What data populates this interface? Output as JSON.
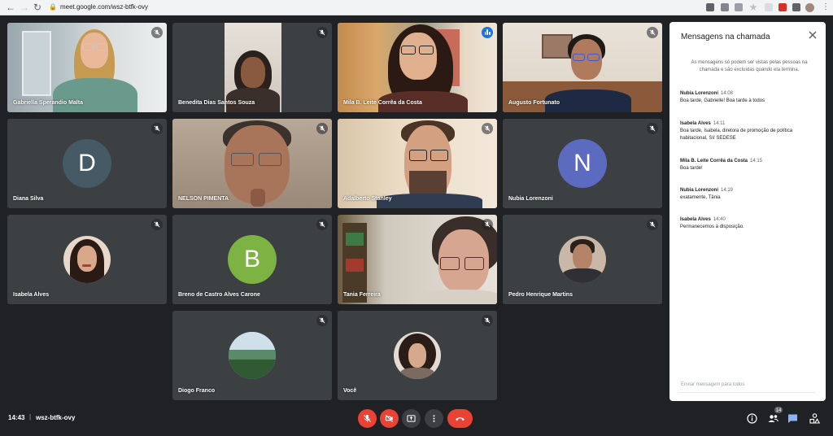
{
  "browser": {
    "url": "meet.google.com/wsz-btfk-ovy",
    "back_glyph": "←",
    "forward_glyph": "→",
    "reload_glyph": "↻"
  },
  "participants": [
    {
      "name": "Gabriella Sperandio Malta",
      "muted": true
    },
    {
      "name": "Benedita Dias Santos Souza",
      "muted": true
    },
    {
      "name": "Mila B. Leite Corrêa da Costa",
      "muted": false,
      "speaking": true
    },
    {
      "name": "Augusto Fortunato",
      "muted": true
    },
    {
      "name": "Diana Silva",
      "muted": true,
      "initial": "D"
    },
    {
      "name": "NELSON PIMENTA",
      "muted": true
    },
    {
      "name": "Adalberto Stanley",
      "muted": true
    },
    {
      "name": "Nubia Lorenzoni",
      "muted": true,
      "initial": "N"
    },
    {
      "name": "Isabela Alves",
      "muted": true
    },
    {
      "name": "Breno de Castro Alves Carone",
      "muted": true,
      "initial": "B"
    },
    {
      "name": "Tania Ferreira",
      "muted": true
    },
    {
      "name": "Pedro Henrique Martins",
      "muted": true
    },
    {
      "name": "Diogo Franco",
      "muted": true
    },
    {
      "name": "Você",
      "muted": true
    }
  ],
  "chat": {
    "title": "Mensagens na chamada",
    "notice": "As mensagens só podem ser vistas pelas pessoas na chamada e são excluídas quando ela termina.",
    "messages": [
      {
        "sender": "Nubia Lorenzoni",
        "time": "14:08",
        "text": "Boa tarde, Gabrielle! Boa tarde à todos"
      },
      {
        "sender": "Isabela Alves",
        "time": "14:11",
        "text": "Boa tarde, Isabela, diretora de promoção de política habitacional, SI/ SEDESE"
      },
      {
        "sender": "Mila B. Leite Corrêa da Costa",
        "time": "14:15",
        "text": "Boa tarde!"
      },
      {
        "sender": "Nubia Lorenzoni",
        "time": "14:19",
        "text": "exatamente, Tânia"
      },
      {
        "sender": "Isabela Alves",
        "time": "14:40",
        "text": "Permanecemos à disposição."
      }
    ],
    "input_placeholder": "Enviar mensagem para todos"
  },
  "footer": {
    "time": "14:43",
    "separator": "|",
    "meeting_code": "wsz-btfk-ovy",
    "people_count": "14"
  },
  "colors": {
    "background": "#202124",
    "tile": "#3c4043",
    "end_call": "#ea4335",
    "active_speaker": "#8ab4f8",
    "avatar_d": "#455a64",
    "avatar_n": "#5c6bc0",
    "avatar_b": "#7cb342"
  }
}
